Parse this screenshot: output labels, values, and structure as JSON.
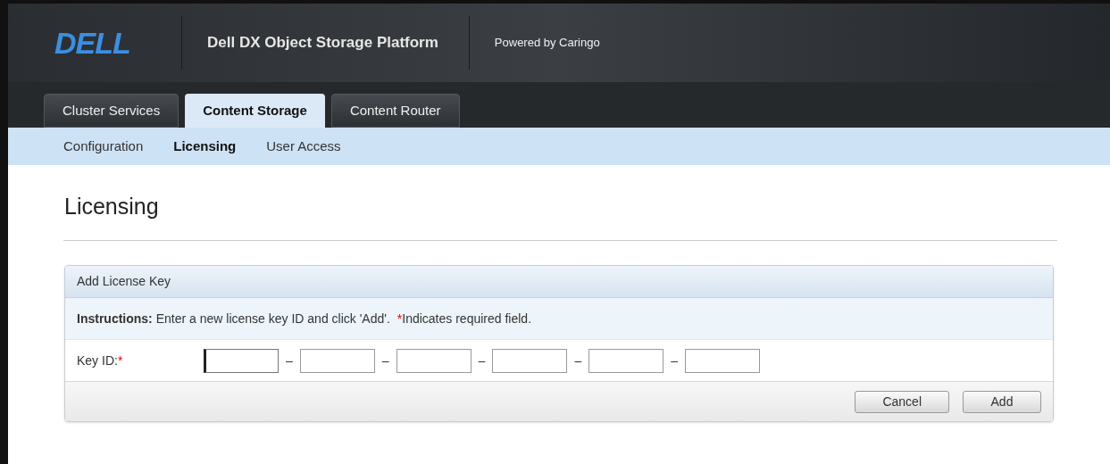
{
  "header": {
    "logo": "DELL",
    "title": "Dell DX Object Storage Platform",
    "powered_by": "Powered by Caringo"
  },
  "tabs": [
    {
      "label": "Cluster Services",
      "selected": false
    },
    {
      "label": "Content Storage",
      "selected": true
    },
    {
      "label": "Content Router",
      "selected": false
    }
  ],
  "subnav": [
    {
      "label": "Configuration",
      "selected": false
    },
    {
      "label": "Licensing",
      "selected": true
    },
    {
      "label": "User Access",
      "selected": false
    }
  ],
  "page_title": "Licensing",
  "panel": {
    "title": "Add License Key",
    "instructions": "**Instructions:** Enter a new license key ID and click 'Add'.",
    "required_note": {
      "mark": "*",
      "text": "Indicates required field."
    },
    "key_id": {
      "label": "Key ID:",
      "required_mark": "*",
      "parts": [
        {
          "kind": "field",
          "focused": true
        },
        {
          "kind": "separator",
          "text": "–"
        },
        {
          "kind": "field",
          "focused": false
        },
        {
          "kind": "separator",
          "text": "–"
        },
        {
          "kind": "field",
          "focused": false
        },
        {
          "kind": "separator",
          "text": "–"
        },
        {
          "kind": "field",
          "focused": false
        },
        {
          "kind": "separator",
          "text": "–"
        },
        {
          "kind": "field",
          "focused": false
        },
        {
          "kind": "separator",
          "text": "–"
        },
        {
          "kind": "field",
          "focused": false
        }
      ]
    },
    "buttons": [
      "Cancel",
      "Add"
    ]
  }
}
